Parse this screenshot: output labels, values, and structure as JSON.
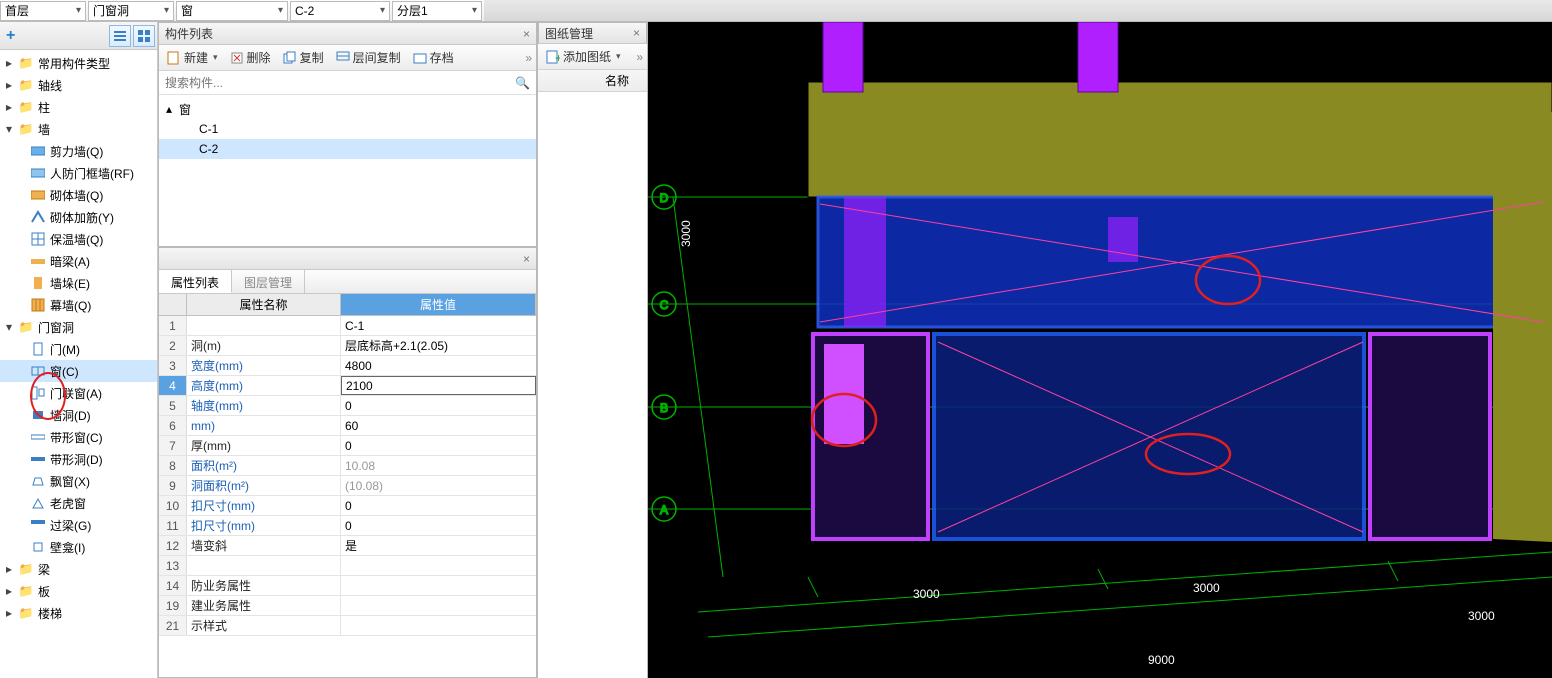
{
  "top": {
    "floor": "首层",
    "cat1": "门窗洞",
    "cat2": "窗",
    "comp": "C-2",
    "layer": "分层1"
  },
  "leftnav": {
    "add_tip": "+",
    "groups": {
      "common": "常用构件类型",
      "axis": "轴线",
      "col": "柱",
      "wall": "墙",
      "wall_children": {
        "shear": "剪力墙(Q)",
        "rf": "人防门框墙(RF)",
        "block": "砌体墙(Q)",
        "reinf": "砌体加筋(Y)",
        "insul": "保温墙(Q)",
        "hidden": "暗梁(A)",
        "stack": "墙垛(E)",
        "curtain": "幕墙(Q)"
      },
      "opening": "门窗洞",
      "opening_children": {
        "door": "门(M)",
        "window": "窗(C)",
        "doorwin": "门联窗(A)",
        "wallhole": "墙洞(D)",
        "stripwin": "带形窗(C)",
        "striphole": "带形洞(D)",
        "bay": "飘窗(X)",
        "dormer": "老虎窗",
        "lintel": "过梁(G)",
        "niche": "壁龛(I)"
      },
      "beam": "梁",
      "slab": "板",
      "stair": "楼梯"
    }
  },
  "complist": {
    "title": "构件列表",
    "new": "新建",
    "delete": "删除",
    "copy": "复制",
    "floorcopy": "层间复制",
    "archive": "存档",
    "search_ph": "搜索构件...",
    "root": "窗",
    "children": [
      "C-1",
      "C-2"
    ]
  },
  "props": {
    "tab_prop": "属性列表",
    "tab_layer": "图层管理",
    "col_name": "属性名称",
    "col_val": "属性值",
    "rows": [
      {
        "n": "1",
        "name": "",
        "val": "C-1",
        "black": true
      },
      {
        "n": "2",
        "name": "洞(m)",
        "val": "层底标高+2.1(2.05)",
        "black": true
      },
      {
        "n": "3",
        "name": "宽度(mm)",
        "val": "4800"
      },
      {
        "n": "4",
        "name": "高度(mm)",
        "val": "2100",
        "sel": true
      },
      {
        "n": "5",
        "name": "轴度(mm)",
        "val": "0"
      },
      {
        "n": "6",
        "name": "mm)",
        "val": "60"
      },
      {
        "n": "7",
        "name": "厚(mm)",
        "val": "0",
        "black": true
      },
      {
        "n": "8",
        "name": "面积(m²)",
        "val": "10.08",
        "gray": true
      },
      {
        "n": "9",
        "name": "洞面积(m²)",
        "val": "(10.08)",
        "gray": true
      },
      {
        "n": "10",
        "name": "扣尺寸(mm)",
        "val": "0"
      },
      {
        "n": "11",
        "name": "扣尺寸(mm)",
        "val": "0"
      },
      {
        "n": "12",
        "name": "墙变斜",
        "val": "是",
        "black": true
      },
      {
        "n": "13",
        "name": "",
        "val": ""
      },
      {
        "n": "14",
        "name": "防业务属性",
        "val": "",
        "black": true
      },
      {
        "n": "19",
        "name": "建业务属性",
        "val": "",
        "black": true
      },
      {
        "n": "21",
        "name": "示样式",
        "val": "",
        "black": true
      }
    ]
  },
  "drawings": {
    "title": "图纸管理",
    "add": "添加图纸",
    "col_name": "名称"
  },
  "viewport": {
    "axis_labels": [
      "D",
      "C",
      "B",
      "A"
    ],
    "dims_h": [
      "3000",
      "3000",
      "3000"
    ],
    "dim_total": "9000",
    "dim_v": "3000"
  }
}
